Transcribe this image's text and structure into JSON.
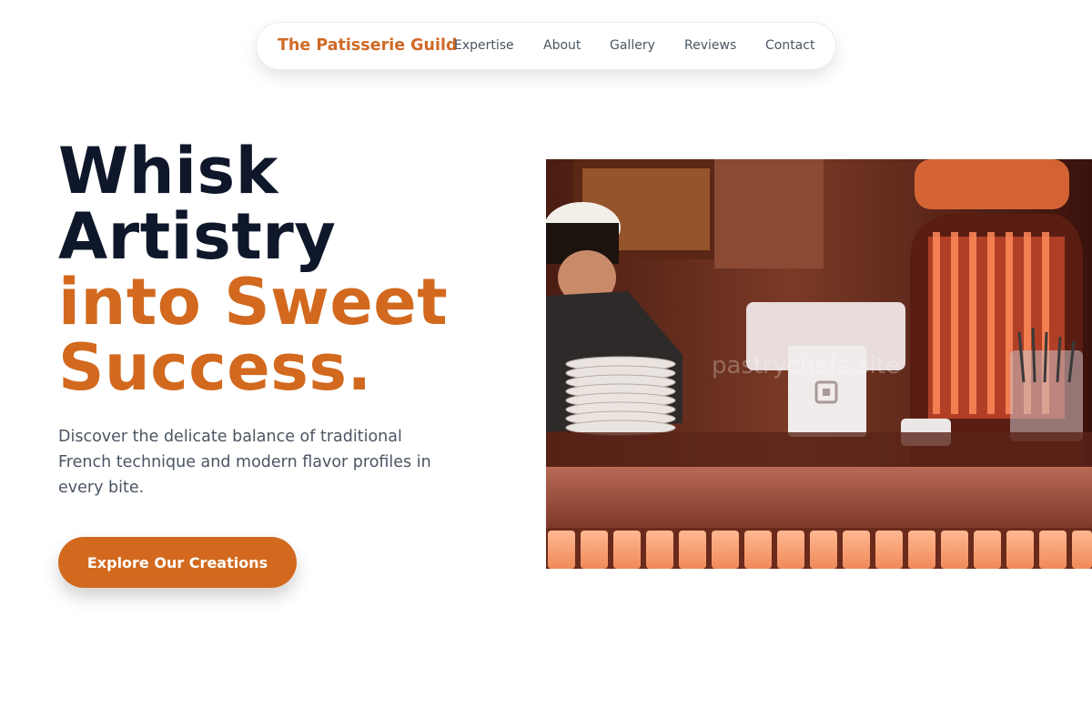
{
  "nav": {
    "brand": "The Patisserie Guild",
    "links": [
      "Expertise",
      "About",
      "Gallery",
      "Reviews",
      "Contact"
    ]
  },
  "hero": {
    "title_line1": "Whisk",
    "title_line2": "Artistry",
    "title_line3": "into Sweet",
    "title_line4": "Success.",
    "subtitle": "Discover the delicate balance of traditional French technique and modern flavor profiles in every bite.",
    "cta_label": "Explore Our Creations"
  },
  "photo": {
    "watermark": "pastrychefs.site"
  },
  "colors": {
    "accent": "#d2691e",
    "heading": "#0f172a",
    "body_text": "#4b5563"
  }
}
